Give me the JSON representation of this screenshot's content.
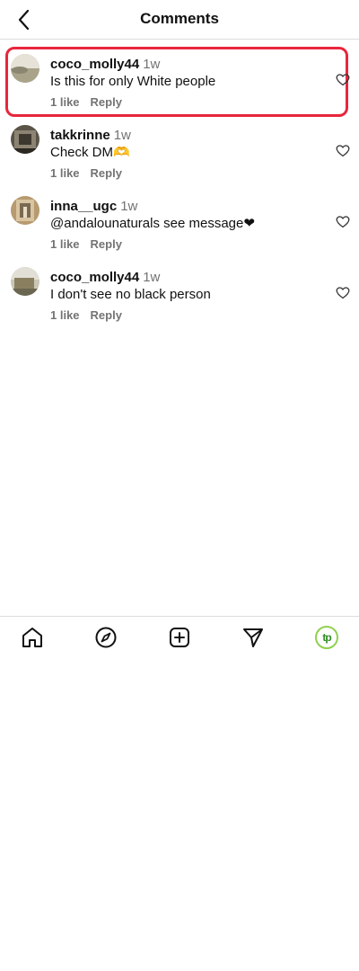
{
  "header": {
    "title": "Comments"
  },
  "comments": [
    {
      "username": "coco_molly44",
      "time": "1w",
      "text": "Is this for only White people",
      "likes": "1 like",
      "reply": "Reply",
      "highlighted": true
    },
    {
      "username": "takkrinne",
      "time": "1w",
      "text": "Check DM🫶",
      "likes": "1 like",
      "reply": "Reply"
    },
    {
      "username": "inna__ugc",
      "time": "1w",
      "text": "@andalounaturals see message❤",
      "likes": "1 like",
      "reply": "Reply"
    },
    {
      "username": "coco_molly44",
      "time": "1w",
      "text": "I don't see no black person",
      "likes": "1 like",
      "reply": "Reply"
    }
  ],
  "nav": {
    "profile_initials": "tp"
  },
  "colors": {
    "highlight": "#e8263d",
    "muted": "#737373",
    "profile_ring": "#8fd14f"
  },
  "icons": [
    "back-arrow-icon",
    "heart-icon",
    "home-icon",
    "compass-icon",
    "add-post-icon",
    "send-icon"
  ]
}
